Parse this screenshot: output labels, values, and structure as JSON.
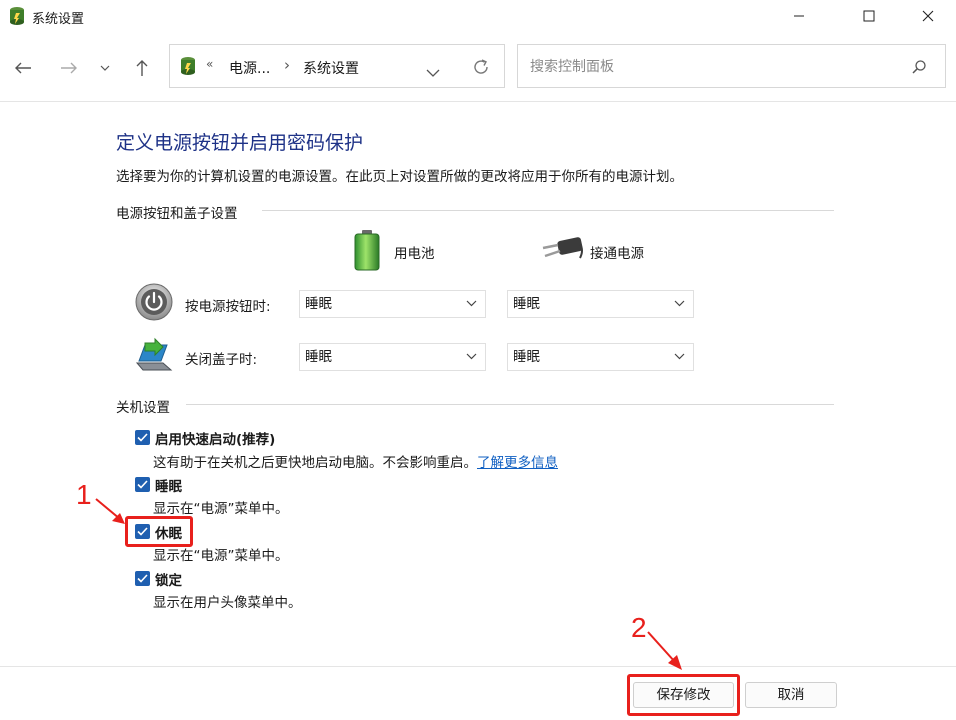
{
  "window": {
    "title": "系统设置",
    "minimize_glyph": "—",
    "close_glyph": "✕"
  },
  "nav": {
    "back_icon": "arrow-left-icon",
    "forward_icon": "arrow-right-icon",
    "up_icon": "arrow-up-icon",
    "breadcrumb_overflow": "«",
    "breadcrumb": [
      "电源...",
      "系统设置"
    ],
    "breadcrumb_sep": "›",
    "search_placeholder": "搜索控制面板"
  },
  "main": {
    "heading": "定义电源按钮并启用密码保护",
    "description": "选择要为你的计算机设置的电源设置。在此页上对设置所做的更改将应用于你所有的电源计划。",
    "power_section": {
      "label": "电源按钮和盖子设置",
      "columns": [
        "用电池",
        "接通电源"
      ],
      "rows": [
        {
          "label": "按电源按钮时:",
          "battery": "睡眠",
          "plugged": "睡眠"
        },
        {
          "label": "关闭盖子时:",
          "battery": "睡眠",
          "plugged": "睡眠"
        }
      ]
    },
    "shutdown_section": {
      "label": "关机设置",
      "items": [
        {
          "title": "启用快速启动(推荐)",
          "desc": "这有助于在关机之后更快地启动电脑。不会影响重启。",
          "link": "了解更多信息",
          "checked": true
        },
        {
          "title": "睡眠",
          "desc": "显示在“电源”菜单中。",
          "checked": true
        },
        {
          "title": "休眠",
          "desc": "显示在“电源”菜单中。",
          "checked": true
        },
        {
          "title": "锁定",
          "desc": "显示在用户头像菜单中。",
          "checked": true
        }
      ]
    }
  },
  "footer": {
    "save_label": "保存修改",
    "cancel_label": "取消"
  },
  "annotations": {
    "marker_1": "1",
    "marker_2": "2",
    "color": "#e8201c"
  },
  "colors": {
    "heading": "#1e3287",
    "checkbox": "#1f5fb0",
    "link": "#0f5fc2"
  }
}
